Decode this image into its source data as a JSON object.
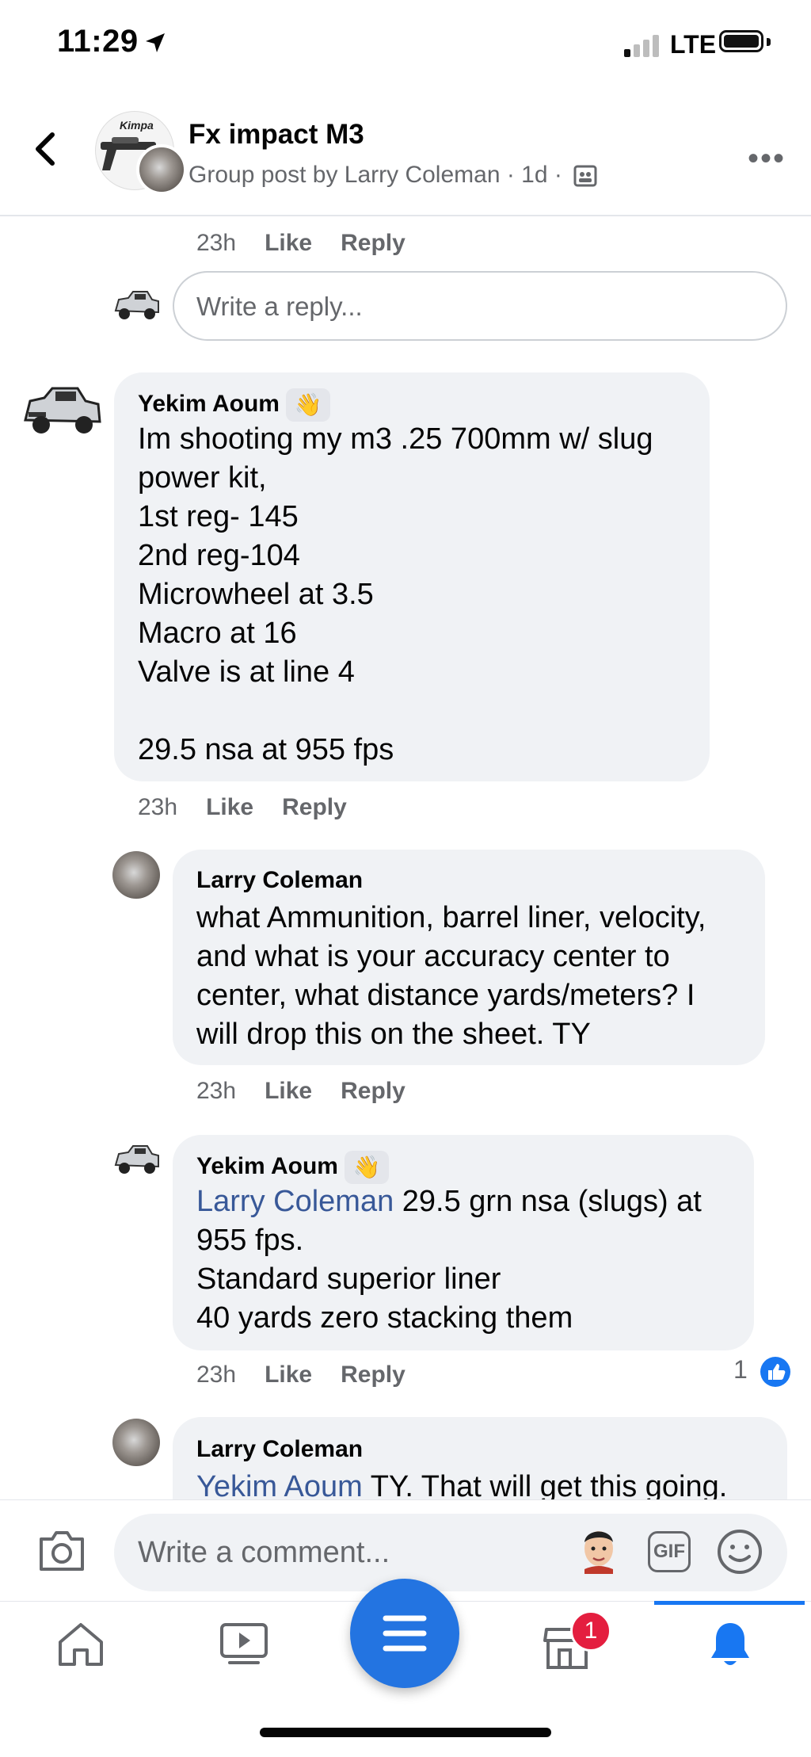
{
  "status_bar": {
    "time": "11:29",
    "network": "LTE"
  },
  "header": {
    "title": "Fx impact M3",
    "subtitle": "Group post by Larry Coleman · 1d ·",
    "avatar_logo_text": "Kimpa"
  },
  "top_meta": {
    "time": "23h",
    "like": "Like",
    "reply": "Reply"
  },
  "reply_box": {
    "placeholder": "Write a reply..."
  },
  "comments": [
    {
      "author": "Yekim Aoum",
      "text": "Im shooting my m3 .25 700mm w/ slug\npower kit,\n1st reg- 145\n2nd reg-104\nMicrowheel at 3.5\nMacro at 16\nValve is at line 4\n\n29.5 nsa at 955 fps",
      "time": "23h",
      "like": "Like",
      "reply": "Reply"
    },
    {
      "author": "Larry Coleman",
      "text": "what Ammunition, barrel liner, velocity,\nand what is your accuracy center to\ncenter, what distance yards/meters? I\nwill drop this on the sheet. TY",
      "time": "23h",
      "like": "Like",
      "reply": "Reply"
    },
    {
      "author": "Yekim Aoum",
      "mention": "Larry Coleman",
      "text_after_mention": " 29.5 grn nsa (slugs) at\n955 fps.\nStandard superior liner\n40 yards zero stacking them",
      "time": "23h",
      "like": "Like",
      "reply": "Reply",
      "reaction_count": "1"
    },
    {
      "author": "Larry Coleman",
      "mention": "Yekim Aoum",
      "text_after_mention": " TY. That will get this going."
    }
  ],
  "composer": {
    "placeholder": "Write a comment...",
    "gif_label": "GIF"
  },
  "tabbar": {
    "marketplace_badge": "1"
  },
  "colors": {
    "accent": "#1877f2",
    "bubble": "#f0f2f5",
    "mention": "#385898",
    "badge": "#e41e3f"
  }
}
